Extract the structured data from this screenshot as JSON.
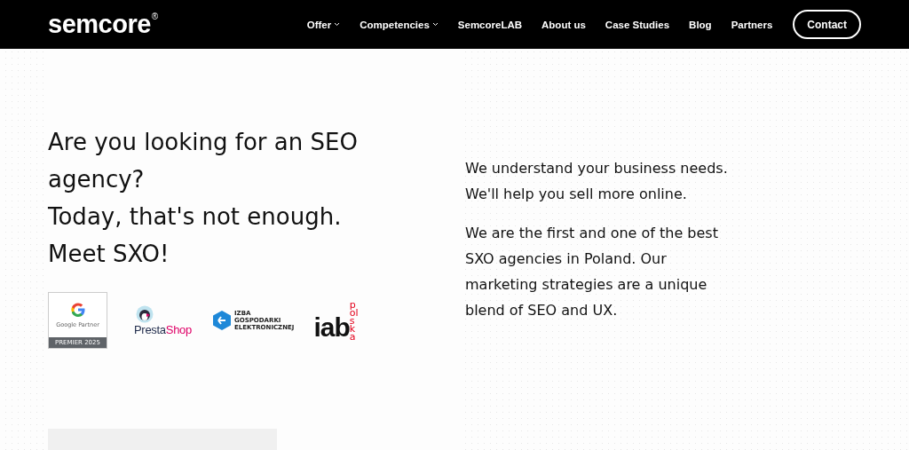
{
  "header": {
    "logo": "semcore",
    "logo_mark": "®",
    "nav": [
      {
        "label": "Offer",
        "has_dropdown": true
      },
      {
        "label": "Competencies",
        "has_dropdown": true
      },
      {
        "label": "SemcoreLAB",
        "has_dropdown": false
      },
      {
        "label": "About us",
        "has_dropdown": false
      },
      {
        "label": "Case Studies",
        "has_dropdown": false
      },
      {
        "label": "Blog",
        "has_dropdown": false
      },
      {
        "label": "Partners",
        "has_dropdown": false
      }
    ],
    "contact_button": "Contact"
  },
  "hero": {
    "headings": [
      "Are you looking for an SEO agency?",
      "Today, that's not enough.",
      "Meet SXO!"
    ],
    "partners": {
      "google": {
        "name": "Google Partner",
        "tier": "PREMIER 2025"
      },
      "prestashop": "PrestaShop",
      "izba": [
        "IZBA",
        "GOSPODARKI",
        "ELEKTRONICZNEJ"
      ],
      "iab": {
        "name": "iab",
        "suffix": "polska"
      }
    },
    "paragraphs": [
      "We understand your business needs. We'll help you sell more online.",
      "We are the first and one of the best SXO agencies in Poland. Our marketing strategies are a unique blend of SEO and UX."
    ]
  }
}
